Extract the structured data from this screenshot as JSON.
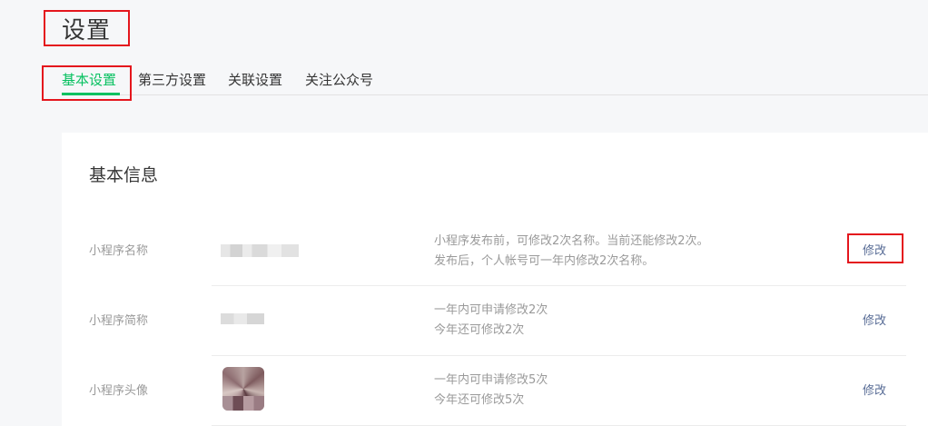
{
  "page": {
    "title": "设置"
  },
  "tabs": [
    {
      "label": "基本设置",
      "active": true
    },
    {
      "label": "第三方设置",
      "active": false
    },
    {
      "label": "关联设置",
      "active": false
    },
    {
      "label": "关注公众号",
      "active": false
    }
  ],
  "basic_info": {
    "section_title": "基本信息",
    "rows": [
      {
        "label": "小程序名称",
        "desc_line1": "小程序发布前，可修改2次名称。当前还能修改2次。",
        "desc_line2": "发布后，个人帐号可一年内修改2次名称。",
        "action": "修改"
      },
      {
        "label": "小程序简称",
        "desc_line1": "一年内可申请修改2次",
        "desc_line2": "今年还可修改2次",
        "action": "修改"
      },
      {
        "label": "小程序头像",
        "desc_line1": "一年内可申请修改5次",
        "desc_line2": "今年还可修改5次",
        "action": "修改"
      }
    ]
  },
  "colors": {
    "accent": "#07c160",
    "link": "#576b95",
    "highlight": "#e4161d"
  }
}
